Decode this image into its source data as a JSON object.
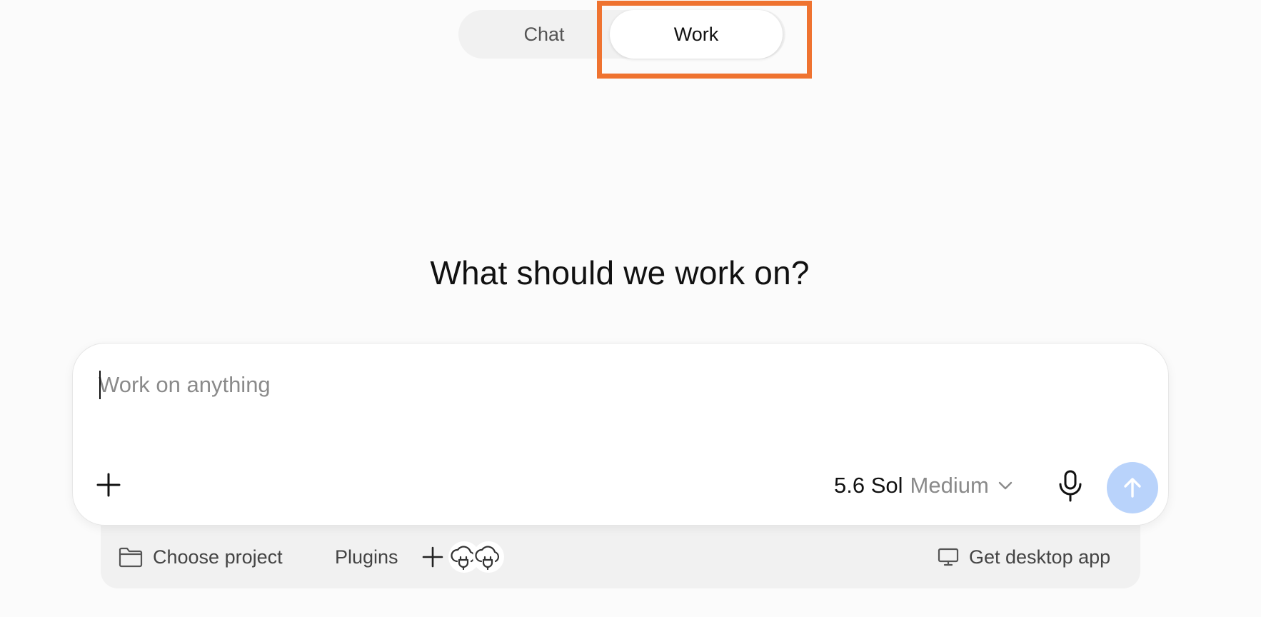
{
  "mode_switch": {
    "tabs": [
      {
        "label": "Chat",
        "selected": false
      },
      {
        "label": "Work",
        "selected": true
      }
    ]
  },
  "headline": "What should we work on?",
  "composer": {
    "placeholder": "Work on anything",
    "value": "",
    "model": {
      "name": "5.6 Sol",
      "effort": "Medium"
    }
  },
  "footer": {
    "choose_project": "Choose project",
    "plugins": "Plugins",
    "get_desktop_app": "Get desktop app"
  },
  "icons": {
    "add": "plus-icon",
    "model_dropdown": "chevron-down-icon",
    "mic": "microphone-icon",
    "send": "arrow-up-icon",
    "folder": "folder-icon",
    "plugin_add": "plus-icon",
    "plugin": "cloud-plug-icon",
    "desktop": "monitor-icon"
  },
  "colors": {
    "highlight": "#ef7330",
    "send_button": "#b9d3fb",
    "background": "#fbfbfb"
  }
}
